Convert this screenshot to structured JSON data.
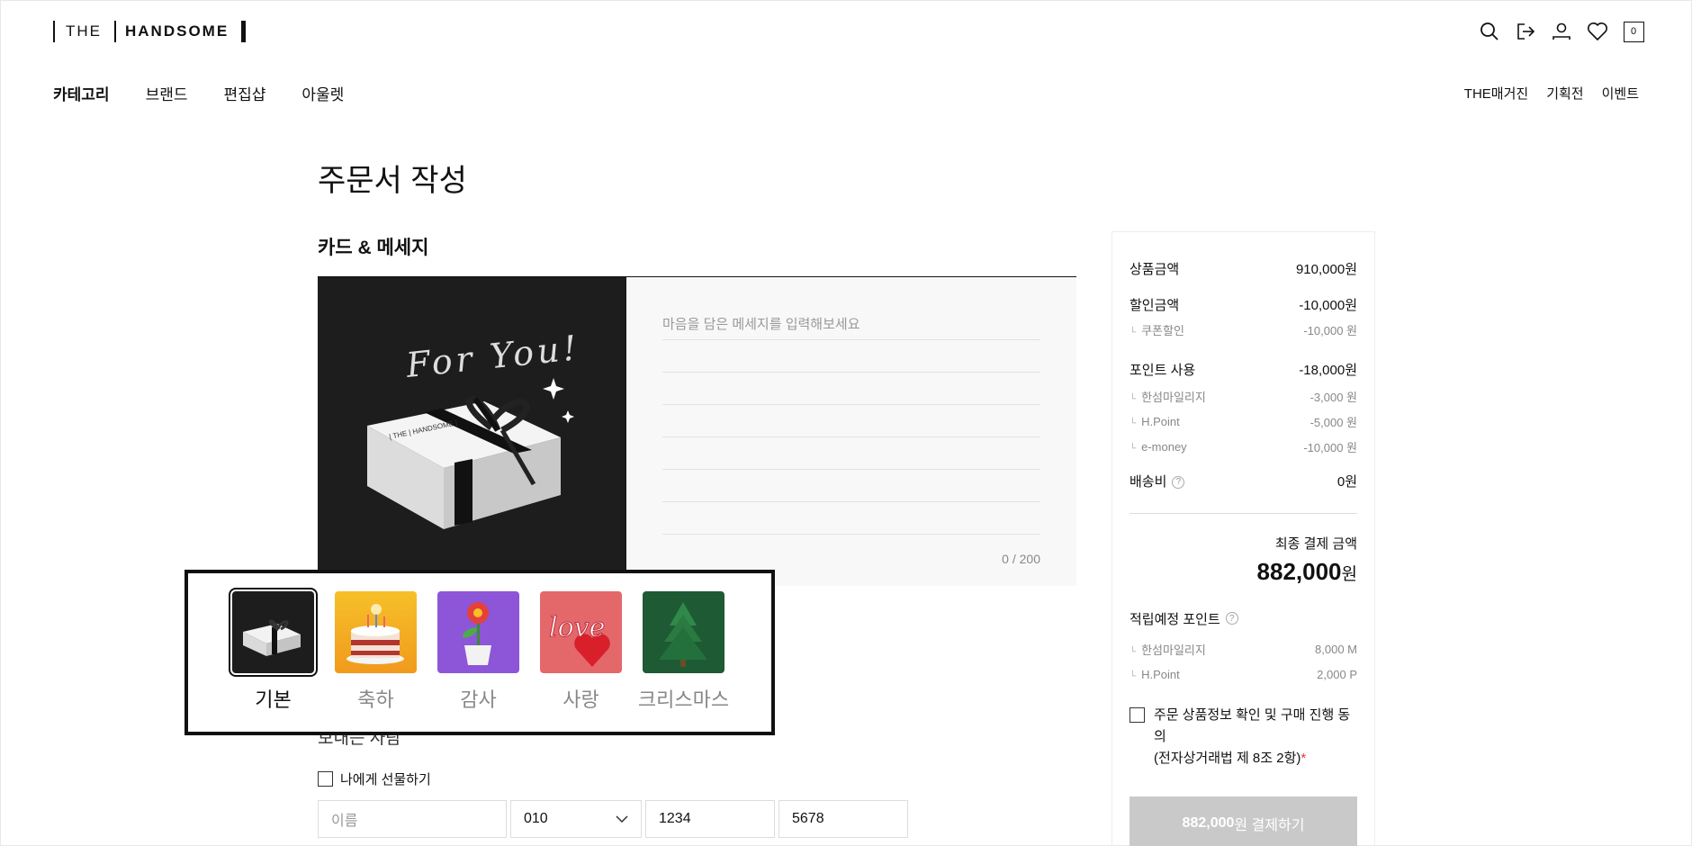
{
  "header": {
    "logo": {
      "word1": "THE",
      "word2": "HANDSOME"
    },
    "icons": [
      "search-icon",
      "logout-icon",
      "user-icon",
      "heart-icon",
      "cart-icon"
    ],
    "cart_count": "0"
  },
  "gnb": {
    "left": [
      "카테고리",
      "브랜드",
      "편집샵",
      "아울렛"
    ],
    "right": [
      "THE매거진",
      "기획전",
      "이벤트"
    ]
  },
  "page": {
    "title": "주문서 작성",
    "section_title": "카드 & 메세지"
  },
  "card": {
    "script_text": "For You!",
    "message_placeholder": "마음을 담은 메세지를 입력해보세요",
    "char_count": "0 / 200"
  },
  "themes": [
    {
      "label": "기본",
      "selected": true
    },
    {
      "label": "축하",
      "selected": false
    },
    {
      "label": "감사",
      "selected": false
    },
    {
      "label": "사랑",
      "selected": false
    },
    {
      "label": "크리스마스",
      "selected": false
    }
  ],
  "sender": {
    "title": "보내는 사람",
    "self_gift_label": "나에게 선물하기",
    "name_placeholder": "이름",
    "phone1": "010",
    "phone2": "1234",
    "phone3": "5678"
  },
  "summary": {
    "product_label": "상품금액",
    "product_value": "910,000",
    "discount_label": "할인금액",
    "discount_value": "-10,000",
    "coupon_label": "쿠폰할인",
    "coupon_value": "-10,000 원",
    "point_label": "포인트 사용",
    "point_value": "-18,000",
    "hanseom_label": "한섬마일리지",
    "hanseom_value": "-3,000 원",
    "hpoint_label": "H.Point",
    "hpoint_value": "-5,000 원",
    "emoney_label": "e-money",
    "emoney_value": "-10,000 원",
    "shipping_label": "배송비",
    "shipping_value": "0",
    "won": "원",
    "final_label": "최종 결제 금액",
    "final_value": "882,000",
    "earn_label": "적립예정 포인트",
    "earn_hanseom_label": "한섬마일리지",
    "earn_hanseom_value": "8,000 M",
    "earn_hpoint_label": "H.Point",
    "earn_hpoint_value": "2,000 P",
    "agree_line1": "주문 상품정보 확인 및 구매 진행 동의",
    "agree_line2": "(전자상거래법 제 8조 2항)",
    "agree_required": "*",
    "pay_amount": "882,000",
    "pay_suffix": "원 결제하기"
  },
  "colors": {
    "card_bg": "#1d1d1d",
    "message_bg": "#f8f8f8",
    "pay_button": "#c9c9c9",
    "required": "#e33333"
  }
}
